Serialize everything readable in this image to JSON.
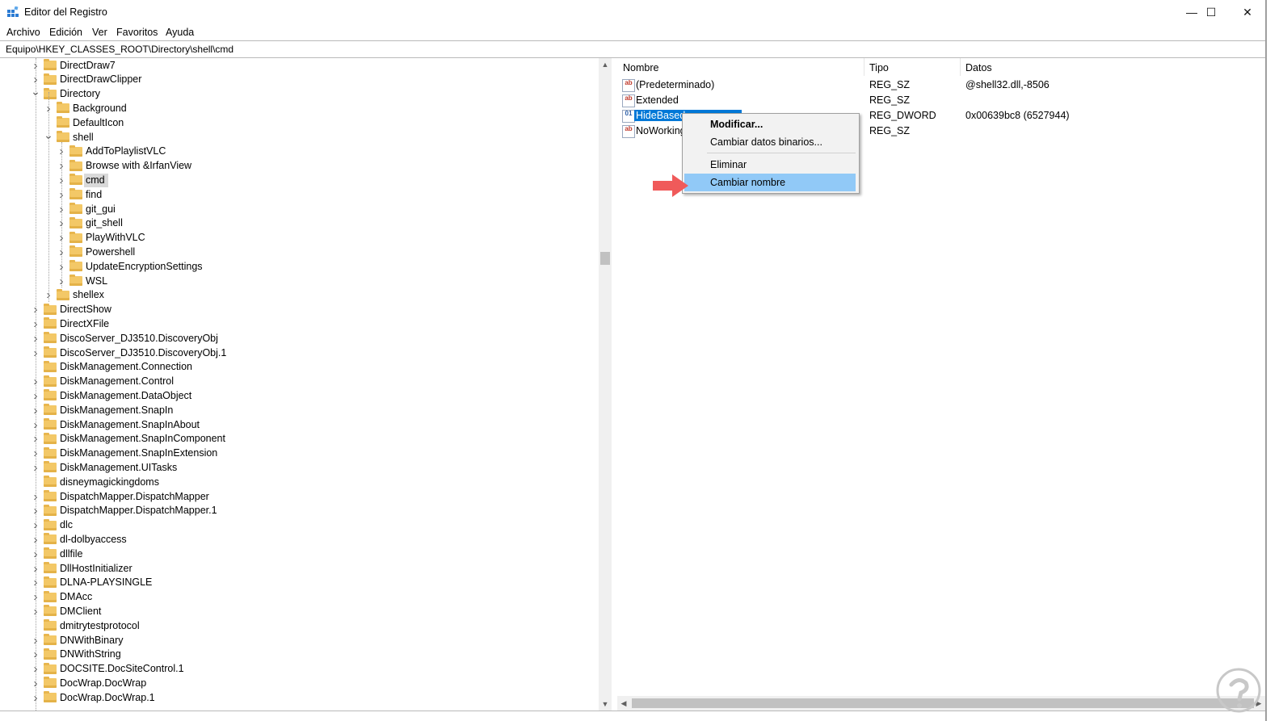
{
  "window": {
    "title": "Editor del Registro",
    "controls": {
      "minimize": "—",
      "maximize": "☐",
      "close": "✕"
    }
  },
  "menu": [
    "Archivo",
    "Edición",
    "Ver",
    "Favoritos",
    "Ayuda"
  ],
  "address": "Equipo\\HKEY_CLASSES_ROOT\\Directory\\shell\\cmd",
  "tree": [
    {
      "label": "DirectDraw7",
      "level": 0,
      "expander": "collapsed"
    },
    {
      "label": "DirectDrawClipper",
      "level": 0,
      "expander": "collapsed"
    },
    {
      "label": "Directory",
      "level": 0,
      "expander": "expanded"
    },
    {
      "label": "Background",
      "level": 1,
      "expander": "collapsed"
    },
    {
      "label": "DefaultIcon",
      "level": 1,
      "expander": "none"
    },
    {
      "label": "shell",
      "level": 1,
      "expander": "expanded"
    },
    {
      "label": "AddToPlaylistVLC",
      "level": 2,
      "expander": "collapsed"
    },
    {
      "label": "Browse with &IrfanView",
      "level": 2,
      "expander": "collapsed"
    },
    {
      "label": "cmd",
      "level": 2,
      "expander": "collapsed",
      "selected": true
    },
    {
      "label": "find",
      "level": 2,
      "expander": "collapsed"
    },
    {
      "label": "git_gui",
      "level": 2,
      "expander": "collapsed"
    },
    {
      "label": "git_shell",
      "level": 2,
      "expander": "collapsed"
    },
    {
      "label": "PlayWithVLC",
      "level": 2,
      "expander": "collapsed"
    },
    {
      "label": "Powershell",
      "level": 2,
      "expander": "collapsed"
    },
    {
      "label": "UpdateEncryptionSettings",
      "level": 2,
      "expander": "collapsed"
    },
    {
      "label": "WSL",
      "level": 2,
      "expander": "collapsed"
    },
    {
      "label": "shellex",
      "level": 1,
      "expander": "collapsed"
    },
    {
      "label": "DirectShow",
      "level": 0,
      "expander": "collapsed"
    },
    {
      "label": "DirectXFile",
      "level": 0,
      "expander": "collapsed"
    },
    {
      "label": "DiscoServer_DJ3510.DiscoveryObj",
      "level": 0,
      "expander": "collapsed"
    },
    {
      "label": "DiscoServer_DJ3510.DiscoveryObj.1",
      "level": 0,
      "expander": "collapsed"
    },
    {
      "label": "DiskManagement.Connection",
      "level": 0,
      "expander": "none"
    },
    {
      "label": "DiskManagement.Control",
      "level": 0,
      "expander": "collapsed"
    },
    {
      "label": "DiskManagement.DataObject",
      "level": 0,
      "expander": "collapsed"
    },
    {
      "label": "DiskManagement.SnapIn",
      "level": 0,
      "expander": "collapsed"
    },
    {
      "label": "DiskManagement.SnapInAbout",
      "level": 0,
      "expander": "collapsed"
    },
    {
      "label": "DiskManagement.SnapInComponent",
      "level": 0,
      "expander": "collapsed"
    },
    {
      "label": "DiskManagement.SnapInExtension",
      "level": 0,
      "expander": "collapsed"
    },
    {
      "label": "DiskManagement.UITasks",
      "level": 0,
      "expander": "collapsed"
    },
    {
      "label": "disneymagickingdoms",
      "level": 0,
      "expander": "none"
    },
    {
      "label": "DispatchMapper.DispatchMapper",
      "level": 0,
      "expander": "collapsed"
    },
    {
      "label": "DispatchMapper.DispatchMapper.1",
      "level": 0,
      "expander": "collapsed"
    },
    {
      "label": "dlc",
      "level": 0,
      "expander": "collapsed"
    },
    {
      "label": "dl-dolbyaccess",
      "level": 0,
      "expander": "collapsed"
    },
    {
      "label": "dllfile",
      "level": 0,
      "expander": "collapsed"
    },
    {
      "label": "DllHostInitializer",
      "level": 0,
      "expander": "collapsed"
    },
    {
      "label": "DLNA-PLAYSINGLE",
      "level": 0,
      "expander": "collapsed"
    },
    {
      "label": "DMAcc",
      "level": 0,
      "expander": "collapsed"
    },
    {
      "label": "DMClient",
      "level": 0,
      "expander": "collapsed"
    },
    {
      "label": "dmitrytestprotocol",
      "level": 0,
      "expander": "none"
    },
    {
      "label": "DNWithBinary",
      "level": 0,
      "expander": "collapsed"
    },
    {
      "label": "DNWithString",
      "level": 0,
      "expander": "collapsed"
    },
    {
      "label": "DOCSITE.DocSiteControl.1",
      "level": 0,
      "expander": "collapsed"
    },
    {
      "label": "DocWrap.DocWrap",
      "level": 0,
      "expander": "collapsed"
    },
    {
      "label": "DocWrap.DocWrap.1",
      "level": 0,
      "expander": "collapsed"
    }
  ],
  "list": {
    "headers": {
      "name": "Nombre",
      "type": "Tipo",
      "data": "Datos"
    },
    "rows": [
      {
        "name": "(Predeterminado)",
        "type": "REG_SZ",
        "data": "@shell32.dll,-8506",
        "icon": "string-value-icon",
        "icon_glyph": "ab"
      },
      {
        "name": "Extended",
        "type": "REG_SZ",
        "data": "",
        "icon": "string-value-icon",
        "icon_glyph": "ab"
      },
      {
        "name": "HideBased",
        "type": "REG_DWORD",
        "data": "0x00639bc8 (6527944)",
        "icon": "dword-value-icon",
        "icon_glyph": "01",
        "selected": true
      },
      {
        "name": "NoWorking",
        "type": "REG_SZ",
        "data": "",
        "icon": "string-value-icon",
        "icon_glyph": "ab"
      }
    ]
  },
  "context_menu": {
    "items": [
      {
        "label": "Modificar...",
        "bold": true
      },
      {
        "label": "Cambiar datos binarios..."
      },
      {
        "label": "Eliminar"
      },
      {
        "label": "Cambiar nombre",
        "highlighted": true
      }
    ]
  },
  "colors": {
    "selection": "#0078d7",
    "menu_highlight": "#91c9f7",
    "folder": "#f3c867",
    "arrow": "#f05a5a"
  }
}
